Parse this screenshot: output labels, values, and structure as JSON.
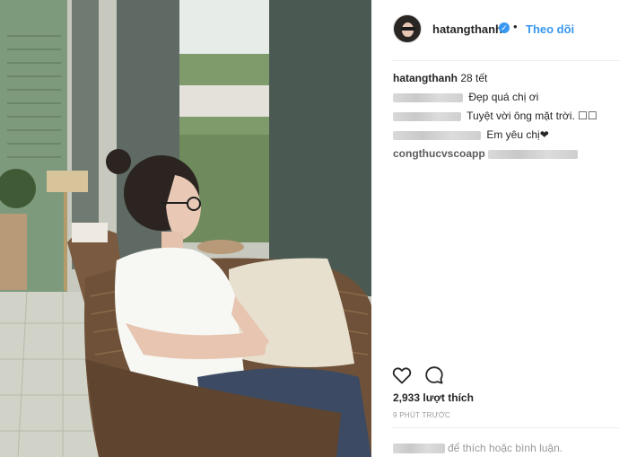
{
  "post": {
    "username": "hatangthanh",
    "follow_label": "Theo dõi",
    "separator": "•",
    "caption_text": "28 tết",
    "likes_text": "2,933 lượt thích",
    "time_text": "9 PHÚT TRƯỚC",
    "login_prompt": "để thích hoặc bình luận."
  },
  "comments": [
    {
      "user": "hatangthanh",
      "text": "28 tết"
    },
    {
      "user": "",
      "text": "Đẹp quá chị ơi"
    },
    {
      "user": "",
      "text": "Tuyệt vời ông mặt trời. ☐☐"
    },
    {
      "user": "",
      "text": "Em yêu chị❤"
    },
    {
      "user": "congthucvscoapp",
      "text": ""
    }
  ],
  "icons": {
    "verified": "verified-badge-icon",
    "like": "heart-outline-icon",
    "comment": "comment-bubble-icon"
  },
  "colors": {
    "link": "#3897f0",
    "text": "#262626",
    "muted": "#999999",
    "divider": "#efefef"
  }
}
